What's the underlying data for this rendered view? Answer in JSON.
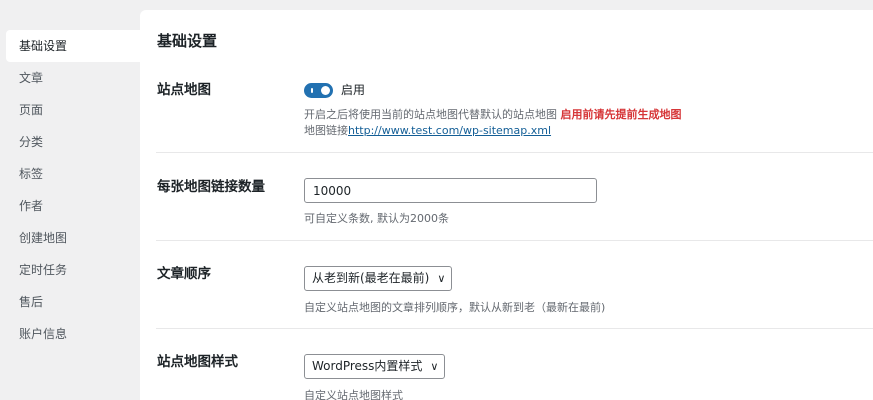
{
  "sidebar": {
    "items": [
      {
        "label": "基础设置",
        "active": true
      },
      {
        "label": "文章"
      },
      {
        "label": "页面"
      },
      {
        "label": "分类"
      },
      {
        "label": "标签"
      },
      {
        "label": "作者"
      },
      {
        "label": "创建地图"
      },
      {
        "label": "定时任务"
      },
      {
        "label": "售后"
      },
      {
        "label": "账户信息"
      }
    ]
  },
  "main": {
    "title": "基础设置",
    "sitemap": {
      "label": "站点地图",
      "toggle_on": true,
      "toggle_label": "启用",
      "desc_text": "开启之后将使用当前的站点地图代替默认的站点地图",
      "desc_warning": "启用前请先提前生成地图",
      "link_prefix": "地图链接",
      "link_url": "http://www.test.com/wp-sitemap.xml"
    },
    "link_count": {
      "label": "每张地图链接数量",
      "value": "10000",
      "desc": "可自定义条数, 默认为2000条"
    },
    "order": {
      "label": "文章顺序",
      "selected": "从老到新(最老在最前)",
      "desc": "自定义站点地图的文章排列顺序，默认从新到老（最新在最前)"
    },
    "style": {
      "label": "站点地图样式",
      "selected": "WordPress内置样式",
      "desc": "自定义站点地图样式"
    }
  },
  "colors": {
    "accent": "#2271b1",
    "warning": "#d63638",
    "link": "#135e96"
  }
}
